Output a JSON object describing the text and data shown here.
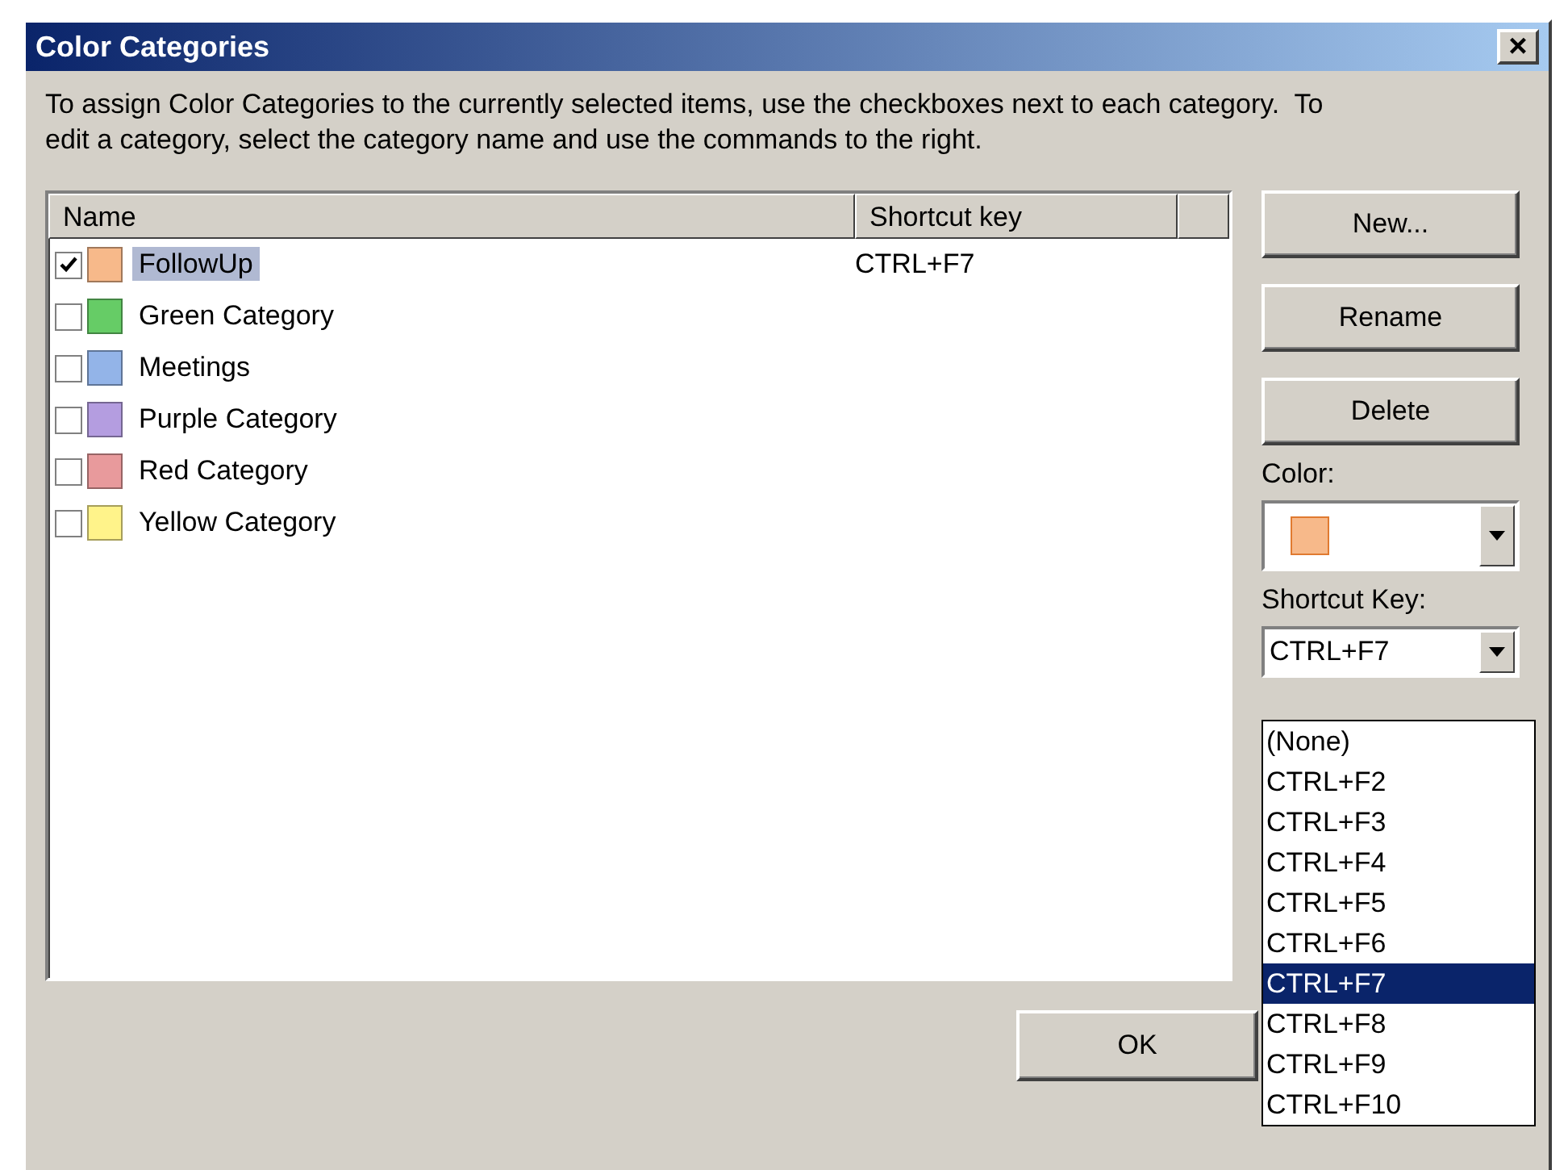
{
  "window": {
    "title": "Color Categories",
    "close": "×"
  },
  "description": "To assign Color Categories to the currently selected items, use the checkboxes next to each category.  To edit a category, select the category name and use the commands to the right.",
  "table": {
    "columns": [
      "Name",
      "Shortcut key"
    ],
    "rows": [
      {
        "name": "FollowUp",
        "shortcut": "CTRL+F7",
        "checked": true,
        "selected": true,
        "color": "#f7b98a"
      },
      {
        "name": "Green Category",
        "checked": false,
        "selected": false,
        "color": "#66cc66"
      },
      {
        "name": "Meetings",
        "checked": false,
        "selected": false,
        "color": "#93b4e8"
      },
      {
        "name": "Purple Category",
        "checked": false,
        "selected": false,
        "color": "#b49de0"
      },
      {
        "name": "Red Category",
        "checked": false,
        "selected": false,
        "color": "#e89a9c"
      },
      {
        "name": "Yellow Category",
        "checked": false,
        "selected": false,
        "color": "#fff38a"
      }
    ]
  },
  "buttons": [
    "New...",
    "Rename",
    "Delete"
  ],
  "color_field": {
    "label": "Color:",
    "color": "#f7b98a"
  },
  "shortcut_field": {
    "label": "Shortcut Key:",
    "value": "CTRL+F7",
    "expanded": true,
    "options": [
      {
        "label": "(None)",
        "selected": false
      },
      {
        "label": "CTRL+F2",
        "selected": false
      },
      {
        "label": "CTRL+F3",
        "selected": false
      },
      {
        "label": "CTRL+F4",
        "selected": false
      },
      {
        "label": "CTRL+F5",
        "selected": false
      },
      {
        "label": "CTRL+F6",
        "selected": false
      },
      {
        "label": "CTRL+F7",
        "selected": true
      },
      {
        "label": "CTRL+F8",
        "selected": false
      },
      {
        "label": "CTRL+F9",
        "selected": false
      },
      {
        "label": "CTRL+F10",
        "selected": false
      }
    ]
  },
  "ok_button": "OK"
}
